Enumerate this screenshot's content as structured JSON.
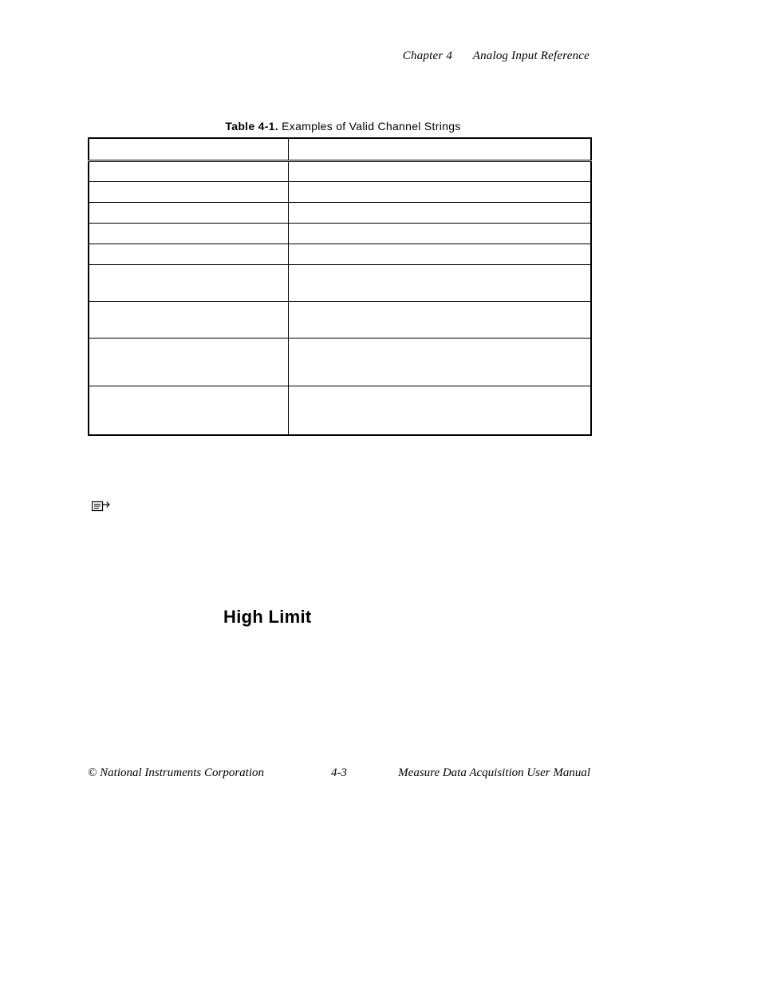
{
  "header": {
    "chapter": "Chapter 4",
    "title": "Analog Input Reference"
  },
  "table": {
    "caption_bold": "Table 4-1.",
    "caption_rest": " Examples of Valid Channel Strings"
  },
  "section": {
    "heading": "High Limit"
  },
  "footer": {
    "left": "© National Instruments Corporation",
    "mid": "4-3",
    "right": "Measure Data Acquisition User Manual"
  }
}
